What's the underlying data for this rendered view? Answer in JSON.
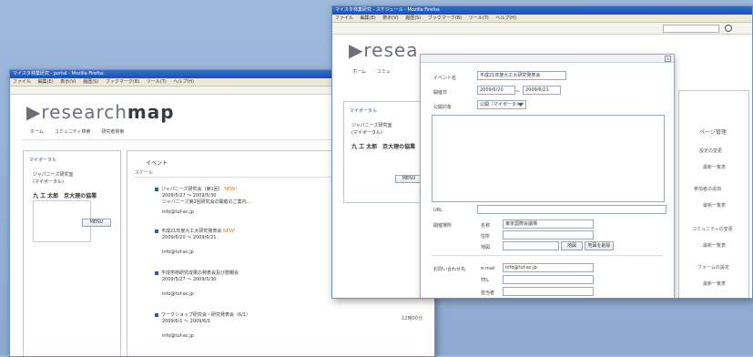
{
  "back_window": {
    "title": "マイスタ林業研究 - portal - Mozilla Firefox",
    "menu": [
      "ファイル",
      "編集(E)",
      "表示(V)",
      "履歴(S)",
      "ブックマーク(B)",
      "ツール(T)",
      "ヘルプ(H)"
    ],
    "logo_light": "▶research",
    "logo_bold": "map",
    "nav": [
      "ホーム",
      "コミュニティ検索",
      "研究者検索"
    ],
    "left_panel": {
      "title": "マイポータル",
      "line1": "ジャパニーズ研究室",
      "line2": "(マイポータル)",
      "name": "九 工 太郎　京大理の協業",
      "button": "MENU"
    },
    "main_title": "イベント",
    "sub_title": "スケール",
    "events": [
      {
        "title": "ジャパニーズ研究会（第1回）",
        "badge": "NEW!",
        "date": "2009/5/27 ～ 2009/5/30",
        "extra": "ジャパニーズ第2回研究会の開催のご案内..."
      },
      {
        "title": "平成21年度九工大研究発表会",
        "badge": "NEW!",
        "date": "2009/6/20 ～ 2009/6/21",
        "extra": ""
      },
      {
        "title": "平成学術研究成果の発表会及び懇親会",
        "badge": "",
        "date": "2009/5/27 ～ 2009/5/30",
        "extra": ""
      },
      {
        "title": "ワークショップ研究会・研究発表会（6/1）",
        "badge": "",
        "date": "2009/6/1 ～ 2009/6/1",
        "extra": ""
      }
    ],
    "contact": "info@tuf-ac.jp",
    "right_label": "12時00分"
  },
  "front_window": {
    "title": "マイスタ林業研究 - スケジュール - Mozilla Firefox",
    "menu": [
      "ファイル",
      "編集(E)",
      "表示(V)",
      "履歴(S)",
      "ブックマーク(B)",
      "ツール(T)",
      "ヘルプ(H)"
    ],
    "logo_light": "▶resea",
    "nav": [
      "ホーム",
      "コミュ"
    ],
    "left_panel": {
      "title": "マイポータル",
      "line1": "ジャパニーズ研究室",
      "line2": "(マイポータル)",
      "name": "九 工 太郎　京大理の協業",
      "button": "MENU"
    },
    "dialog": {
      "fields": {
        "title_label": "イベント名",
        "title_value": "平成21年度九工大研究発表会",
        "date_label": "開催日",
        "date_from": "2009/6/20",
        "date_sep": "～",
        "date_to": "2009/6/21",
        "public_label": "公開対象",
        "public_value": "公開（マイポータル）",
        "url_label": "URL",
        "place_label": "開催場所",
        "place_name_label": "名称",
        "place_name_value": "東京国際会議場",
        "place_addr_label": "住所",
        "place_map_label": "地図",
        "map_button": "地図",
        "map_clear_button": "地図を削除",
        "contact_label": "お問い合わせ先",
        "email_label": "e-mail",
        "email_value": "info@tuf-ac.jp",
        "tel_label": "TEL",
        "person_label": "担当者"
      }
    },
    "right_column": [
      "ページ管理",
      "設定の変更",
      "最新一覧表",
      "参加者の追加",
      "最新一覧表",
      "コミュニティの変更",
      "最新一覧表",
      "フォームの設定",
      "最新一覧表"
    ]
  }
}
